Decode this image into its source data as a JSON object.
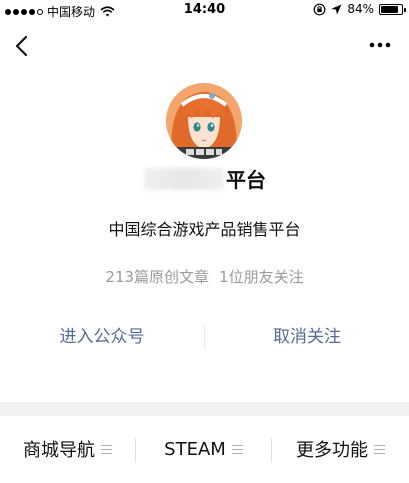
{
  "status_bar": {
    "carrier": "中国移动",
    "time": "14:40",
    "battery_percent": "84%",
    "battery_level": 0.84,
    "signal_bars_filled": 4,
    "signal_bars_total": 5,
    "icons": [
      "wifi-icon",
      "orientation-lock-icon",
      "location-arrow-icon",
      "battery-icon"
    ]
  },
  "nav": {
    "back_icon": "chevron-left-icon",
    "more_icon": "more-dots-icon"
  },
  "profile": {
    "name_visible": "平台",
    "description": "中国综合游戏产品销售平台",
    "article_count": "213篇原创文章",
    "friends_following": "1位朋友关注"
  },
  "actions": {
    "enter_label": "进入公众号",
    "unfollow_label": "取消关注"
  },
  "menu": {
    "items": [
      {
        "label": "商城导航"
      },
      {
        "label": "STEAM"
      },
      {
        "label": "更多功能"
      }
    ]
  },
  "colors": {
    "link": "#576b95",
    "text": "#111111",
    "muted": "#9b9b9b",
    "band": "#f2f2f2"
  }
}
